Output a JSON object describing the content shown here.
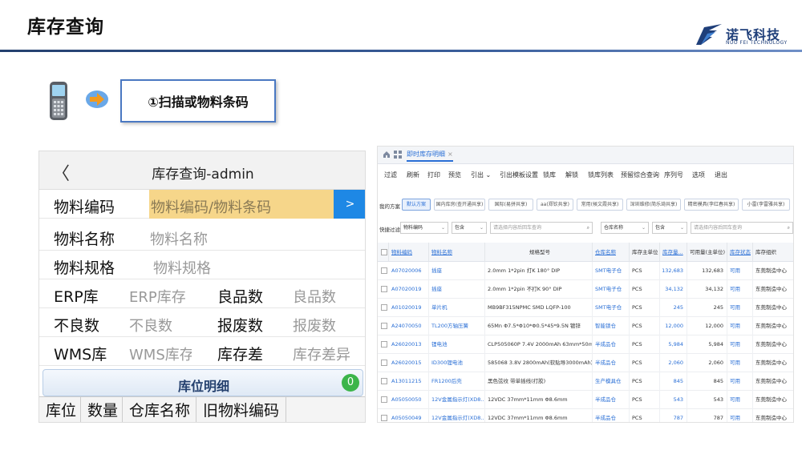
{
  "slide": {
    "title": "库存查询",
    "logo_cn": "诺飞科技",
    "logo_en": "NUO FEI TECHNOLOGY",
    "step_label": "①扫描或物料条码"
  },
  "mobile": {
    "back_icon": "chevron-left-icon",
    "title": "库存查询-admin",
    "fields": {
      "code_label": "物料编码",
      "code_placeholder": "物料编码/物料条码",
      "go_label": ">",
      "name_label": "物料名称",
      "name_placeholder": "物料名称",
      "spec_label": "物料规格",
      "spec_placeholder": "物料规格",
      "erp_label": "ERP库",
      "erp_placeholder": "ERP库存",
      "good_label": "良品数",
      "good_placeholder": "良品数",
      "bad_label": "不良数",
      "bad_placeholder": "不良数",
      "scrap_label": "报废数",
      "scrap_placeholder": "报废数",
      "wms_label": "WMS库",
      "wms_placeholder": "WMS库存",
      "diff_label": "库存差",
      "diff_placeholder": "库存差异"
    },
    "detail": {
      "title": "库位明细",
      "count": "0",
      "columns": [
        "库位",
        "数量",
        "仓库名称",
        "旧物料编码"
      ]
    }
  },
  "erp": {
    "tab": "即时库存明细",
    "tab_close": "×",
    "toolbar": [
      "过滤",
      "刷新",
      "打印",
      "预览",
      "引出 ⌄",
      "引出模板设置",
      "锁库",
      "解锁",
      "锁库列表",
      "预留综合查询",
      "序列号",
      "选项",
      "退出"
    ],
    "scheme_label": "我的方案",
    "schemes": [
      "默认方案",
      "国内库房(查开通共享)",
      "国际(易拼共享)",
      "aa(郑钦共享)",
      "常用(候文霞共享)",
      "深圳维修(简乐琦共享)",
      "精密模具(李红春共享)",
      "小雷(李雷雅共享)"
    ],
    "filter_label": "快捷过滤",
    "filters": [
      {
        "field": "物料编码",
        "op": "包含",
        "placeholder": "请选择内容后回车查询"
      },
      {
        "field": "仓库名称",
        "op": "包含",
        "placeholder": "请选择内容后回车查询"
      }
    ],
    "columns": [
      "物料编码",
      "物料名称",
      "规格型号",
      "仓库名称",
      "库存主单位",
      "库存量...",
      "可用量(主单位)",
      "库存状态",
      "库存组织"
    ],
    "rows": [
      {
        "code": "A07020006",
        "name": "插座",
        "spec": "2.0mm 1*2pin 打K 180° DIP",
        "wh": "SMT电子仓",
        "unit": "PCS",
        "qty": "132,683",
        "avail": "132,683",
        "status": "可用",
        "org": "东莞制造中心"
      },
      {
        "code": "A07020019",
        "name": "插座",
        "spec": "2.0mm 1*2pin 不打K 90° DIP",
        "wh": "SMT电子仓",
        "unit": "PCS",
        "qty": "34,132",
        "avail": "34,132",
        "status": "可用",
        "org": "东莞制造中心"
      },
      {
        "code": "A01020019",
        "name": "单片机",
        "spec": "MB9BF315NPMC SMD LQFP-100",
        "wh": "SMT电子仓",
        "unit": "PCS",
        "qty": "245",
        "avail": "245",
        "status": "可用",
        "org": "东莞制造中心"
      },
      {
        "code": "A24070050",
        "name": "TL200方轴压簧",
        "spec": "65Mn Φ7.5*Φ10*Φ0.5*45*9.5N 镀锌",
        "wh": "智能锁仓",
        "unit": "PCS",
        "qty": "12,000",
        "avail": "12,000",
        "status": "可用",
        "org": "东莞制造中心"
      },
      {
        "code": "A26020013",
        "name": "锂电池",
        "spec": "CLP505060P 7.4V 2000mAh 63mm*50m...",
        "wh": "半成品仓",
        "unit": "PCS",
        "qty": "5,984",
        "avail": "5,984",
        "status": "可用",
        "org": "东莞制造中心"
      },
      {
        "code": "A26020015",
        "name": "ID300锂电池",
        "spec": "585068 3.8V 2800mAh(软贴导3000mAh) ...",
        "wh": "半成品仓",
        "unit": "PCS",
        "qty": "2,060",
        "avail": "2,060",
        "status": "可用",
        "org": "东莞制造中心"
      },
      {
        "code": "A13011215",
        "name": "FR1200后壳",
        "spec": "黑色弦纹 带单插线(打胶)",
        "wh": "生产模具仓",
        "unit": "PCS",
        "qty": "845",
        "avail": "845",
        "status": "可用",
        "org": "东莞制造中心"
      },
      {
        "code": "A05050050",
        "name": "12V金属指示灯(XD8...",
        "spec": "12VDC 37mm*11mm Φ8.6mm",
        "wh": "半成品仓",
        "unit": "PCS",
        "qty": "543",
        "avail": "543",
        "status": "可用",
        "org": "东莞制造中心"
      },
      {
        "code": "A05050049",
        "name": "12V金属指示灯(XD8...",
        "spec": "12VDC 37mm*11mm Φ8.6mm",
        "wh": "半成品仓",
        "unit": "PCS",
        "qty": "787",
        "avail": "787",
        "status": "可用",
        "org": "东莞制造中心"
      }
    ]
  },
  "colors": {
    "accent": "#2a6fd6",
    "highlight": "#f6d68a",
    "go_button": "#1e88e5",
    "badge": "#3cb54a",
    "header_line": "#24406e"
  }
}
